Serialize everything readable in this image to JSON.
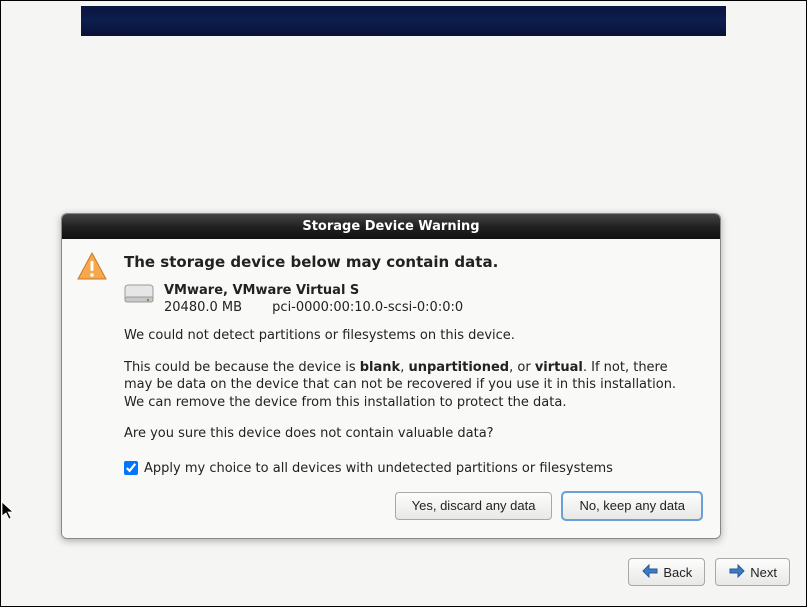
{
  "dialog": {
    "title": "Storage Device Warning",
    "heading": "The storage device below may contain data.",
    "device": {
      "name": "VMware, VMware Virtual S",
      "size": "20480.0 MB",
      "path": "pci-0000:00:10.0-scsi-0:0:0:0"
    },
    "para1": "We could not detect partitions or filesystems on this device.",
    "para2_pre": "This could be because the device is ",
    "para2_b1": "blank",
    "para2_comma": ", ",
    "para2_b2": "unpartitioned",
    "para2_mid": ", or ",
    "para2_b3": "virtual",
    "para2_post": ". If not, there may be data on the device that can not be recovered if you use it in this installation. We can remove the device from this installation to protect the data.",
    "para3": "Are you sure this device does not contain valuable data?",
    "checkbox_label": "Apply my choice to all devices with undetected partitions or filesystems",
    "checkbox_checked": true,
    "btn_discard": "Yes, discard any data",
    "btn_keep": "No, keep any data"
  },
  "nav": {
    "back": "Back",
    "next": "Next"
  }
}
